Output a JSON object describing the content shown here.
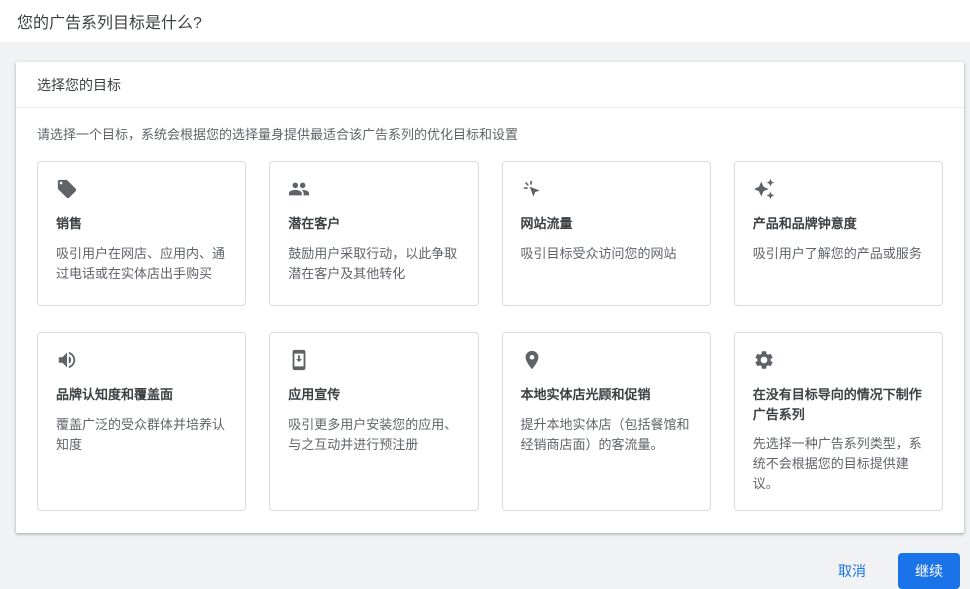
{
  "page": {
    "title": "您的广告系列目标是什么?"
  },
  "panel": {
    "header": "选择您的目标",
    "subtitle": "请选择一个目标，系统会根据您的选择量身提供最适合该广告系列的优化目标和设置"
  },
  "goals": [
    {
      "icon": "tag-icon",
      "title": "销售",
      "description": "吸引用户在网店、应用内、通过电话或在实体店出手购买"
    },
    {
      "icon": "people-icon",
      "title": "潜在客户",
      "description": "鼓励用户采取行动，以此争取潜在客户及其他转化"
    },
    {
      "icon": "cursor-click-icon",
      "title": "网站流量",
      "description": "吸引目标受众访问您的网站"
    },
    {
      "icon": "sparkles-icon",
      "title": "产品和品牌钟意度",
      "description": "吸引用户了解您的产品或服务"
    },
    {
      "icon": "speaker-icon",
      "title": "品牌认知度和覆盖面",
      "description": "覆盖广泛的受众群体并培养认知度"
    },
    {
      "icon": "phone-download-icon",
      "title": "应用宣传",
      "description": "吸引更多用户安装您的应用、与之互动并进行预注册"
    },
    {
      "icon": "location-pin-icon",
      "title": "本地实体店光顾和促销",
      "description": "提升本地实体店（包括餐馆和经销商店面）的客流量。"
    },
    {
      "icon": "gear-icon",
      "title": "在没有目标导向的情况下制作广告系列",
      "description": "先选择一种广告系列类型，系统不会根据您的目标提供建议。"
    }
  ],
  "footer": {
    "cancel_label": "取消",
    "continue_label": "继续"
  },
  "colors": {
    "accent_blue": "#1a73e8",
    "icon_gray": "#5f6368",
    "background_gray": "#f1f2f3",
    "card_border": "#dadce0"
  }
}
